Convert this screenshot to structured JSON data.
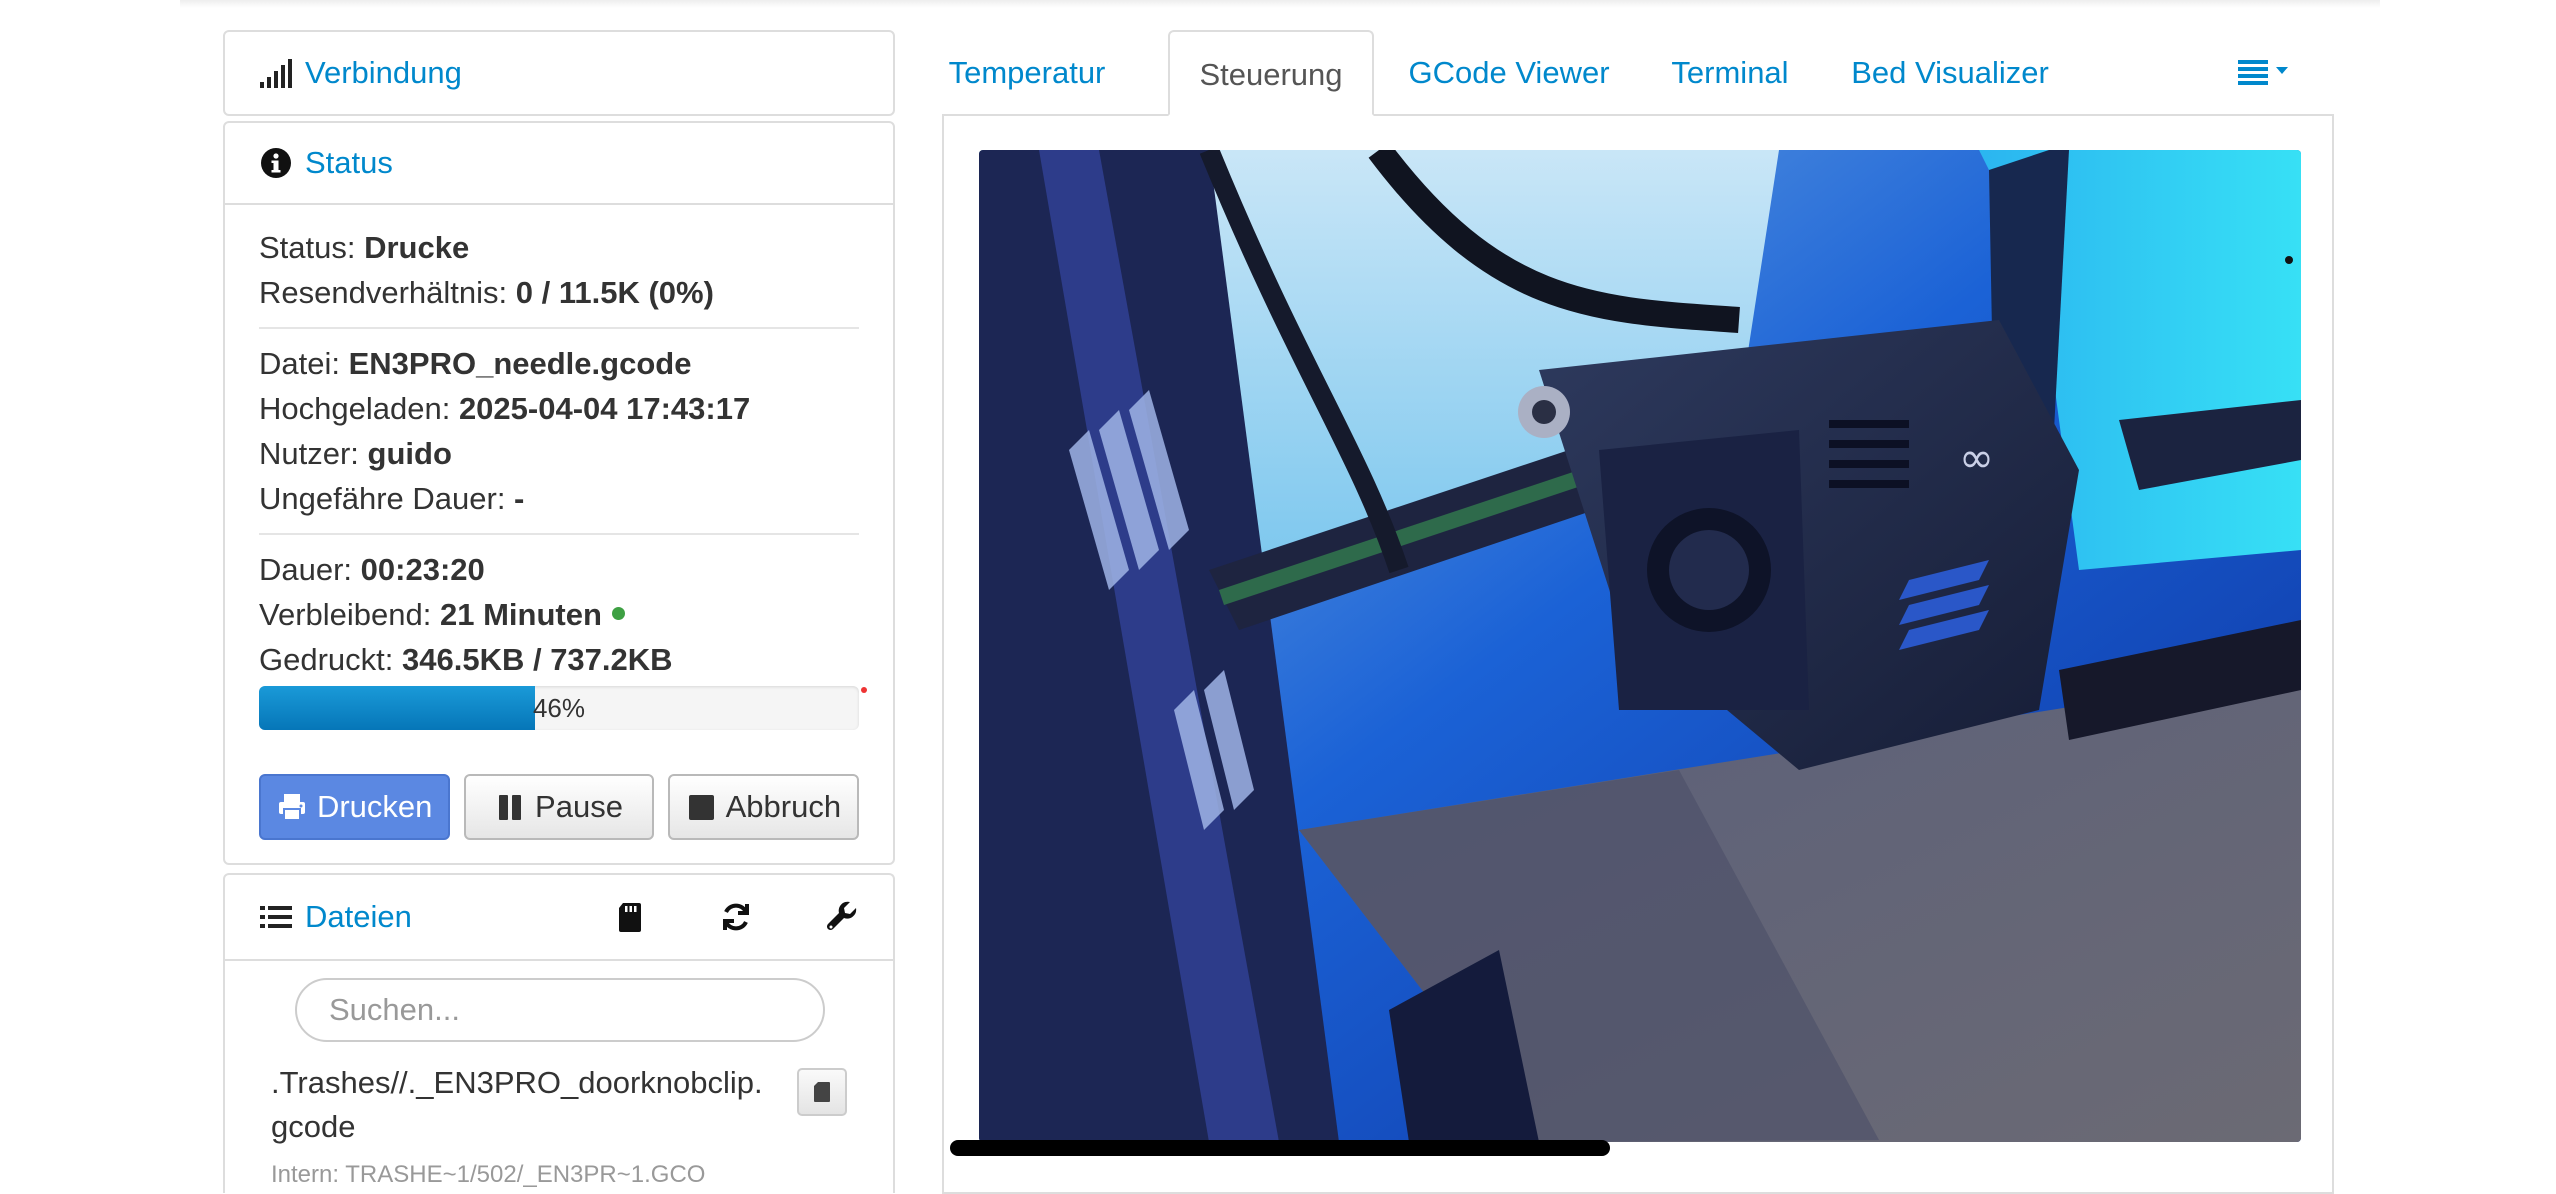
{
  "connection": {
    "title": "Verbindung",
    "icon": "signal-icon"
  },
  "status": {
    "title": "Status",
    "icon": "info-circle-icon",
    "rows_a": [
      {
        "label": "Status: ",
        "value": "Drucke"
      },
      {
        "label": "Resendverhältnis: ",
        "value": "0 / 11.5K (0%)"
      }
    ],
    "rows_b": [
      {
        "label": "Datei: ",
        "value": "EN3PRO_needle.gcode"
      },
      {
        "label": "Hochgeladen: ",
        "value": "2025-04-04 17:43:17"
      },
      {
        "label": "Nutzer: ",
        "value": "guido"
      },
      {
        "label": "Ungefähre Dauer: ",
        "value": "-"
      }
    ],
    "rows_c": [
      {
        "label": "Dauer: ",
        "value": "00:23:20"
      },
      {
        "label": "Verbleibend: ",
        "value": "21 Minuten"
      },
      {
        "label": "Gedruckt: ",
        "value": "346.5KB / 737.2KB"
      }
    ],
    "progress": {
      "percent": 46,
      "label": "46%"
    },
    "buttons": {
      "print": "Drucken",
      "pause": "Pause",
      "abort": "Abbruch"
    },
    "colors": {
      "primary": "#5b88e2",
      "progress": "#0676b8",
      "remaining_dot": "#3ea043",
      "link": "#0088cc"
    }
  },
  "files": {
    "title": "Dateien",
    "icons": [
      "sd-card-icon",
      "refresh-icon",
      "wrench-icon"
    ],
    "search_placeholder": "Suchen...",
    "item": {
      "name": ".Trashes//._EN3PRO_doorknobclip.\ngcode",
      "sub": "Intern: TRASHE~1/502/_EN3PR~1.GCO"
    }
  },
  "tabs": [
    {
      "label": "Temperatur",
      "active": false
    },
    {
      "label": "Steuerung",
      "active": true
    },
    {
      "label": "GCode Viewer",
      "active": false
    },
    {
      "label": "Terminal",
      "active": false
    },
    {
      "label": "Bed Visualizer",
      "active": false
    }
  ],
  "tab_menu_icon": "list-dropdown-icon",
  "webcam": {
    "description": "printer-webcam-image"
  }
}
